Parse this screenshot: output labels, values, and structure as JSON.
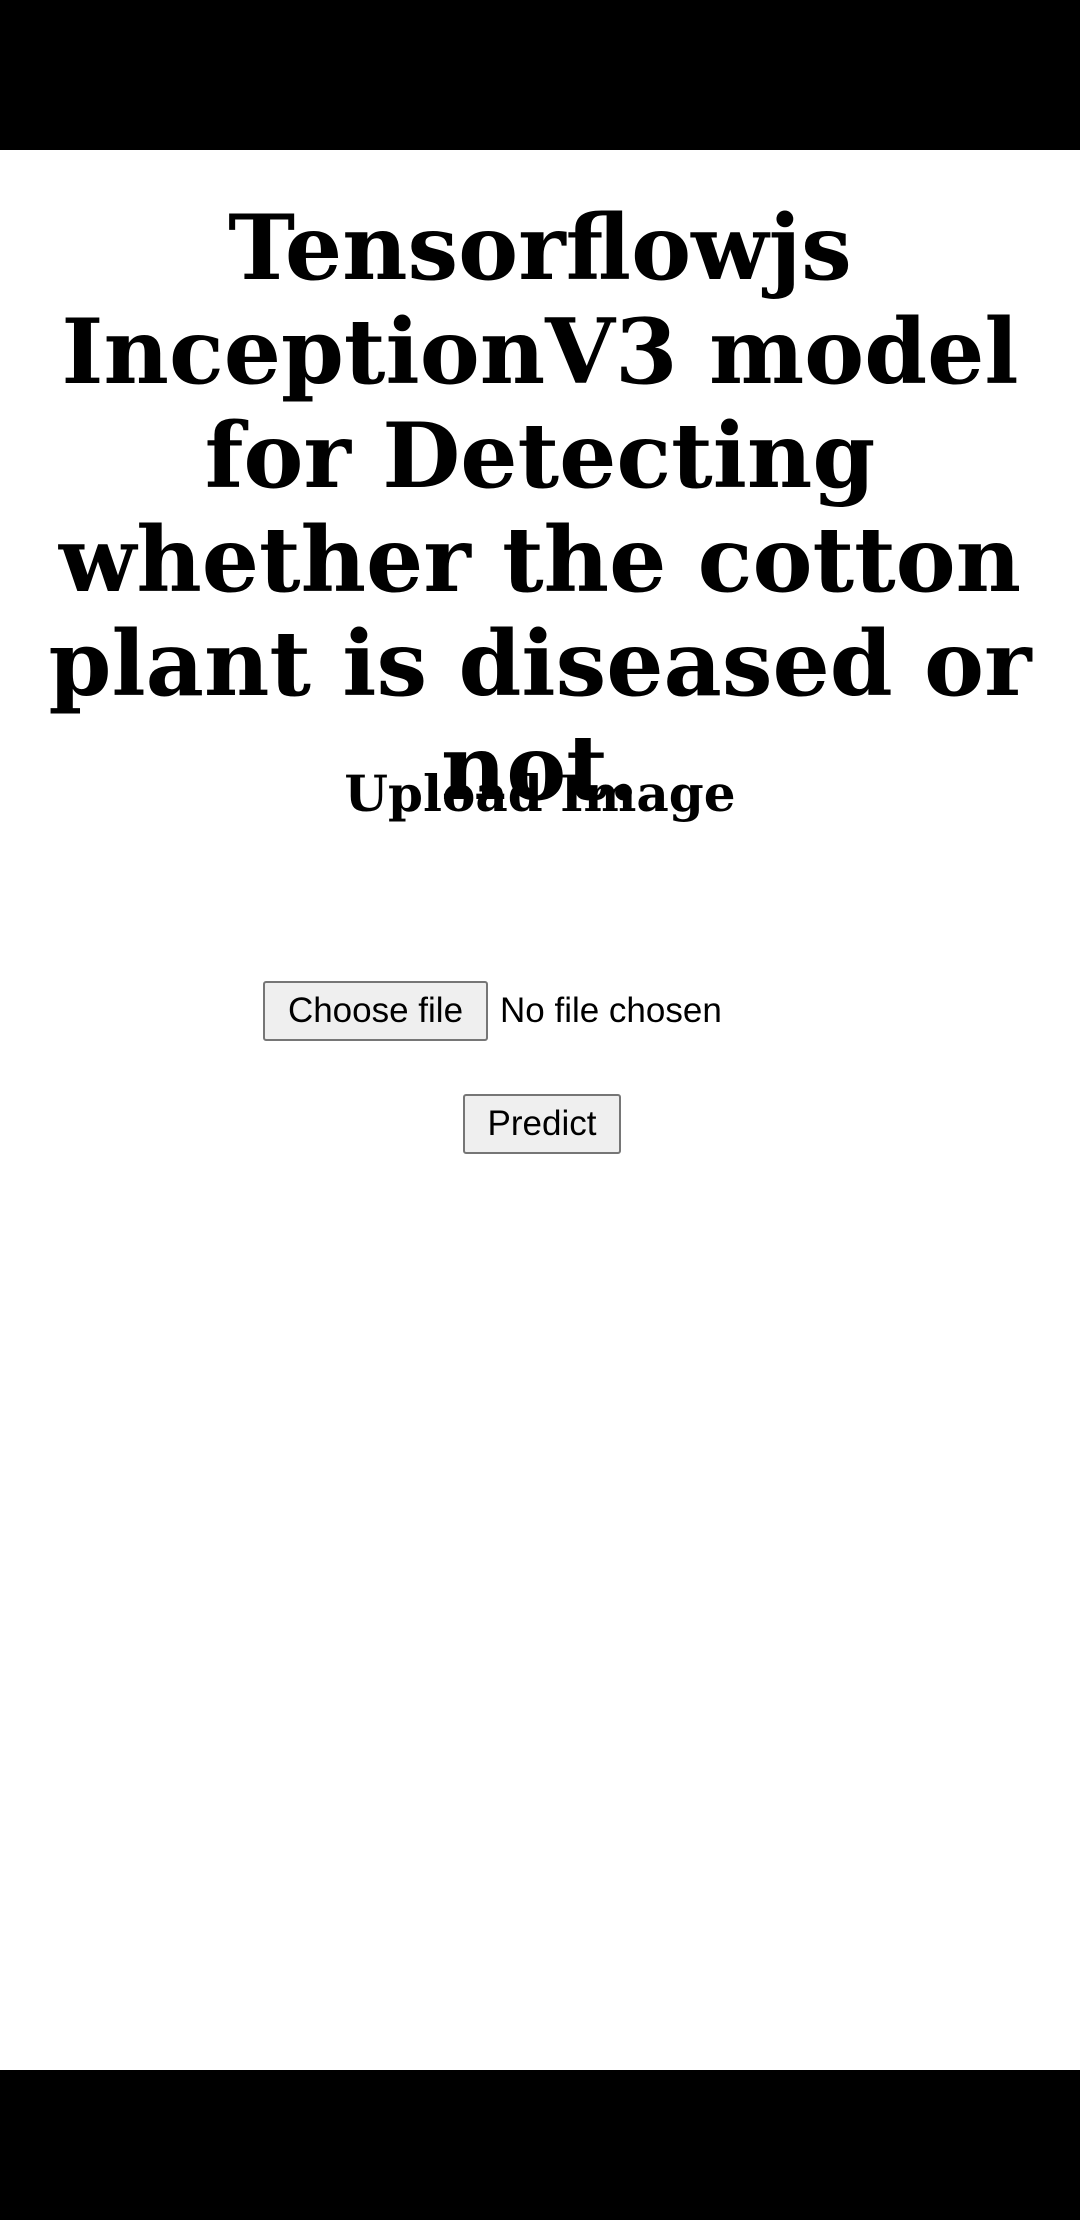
{
  "header": {
    "title": "Tensorflowjs InceptionV3 model for Detecting whether the cotton plant is diseased or not.",
    "subtitle": "Upload Image"
  },
  "upload": {
    "choose_file_label": "Choose file",
    "file_status": "No file chosen"
  },
  "actions": {
    "predict_label": "Predict"
  }
}
